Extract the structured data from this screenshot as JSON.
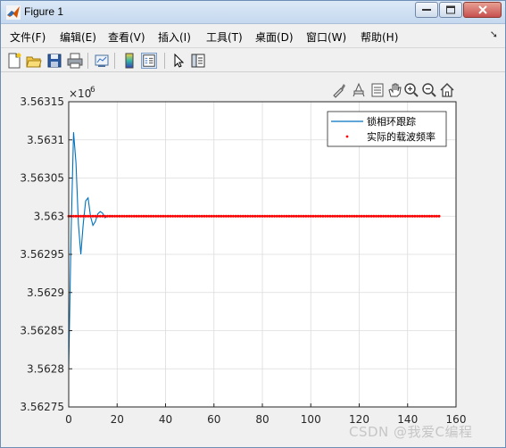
{
  "window": {
    "title": "Figure 1"
  },
  "menu": {
    "items": [
      "文件(F)",
      "编辑(E)",
      "查看(V)",
      "插入(I)",
      "工具(T)",
      "桌面(D)",
      "窗口(W)",
      "帮助(H)"
    ]
  },
  "toolbar": {
    "buttons": [
      "new-figure-icon",
      "open-file-icon",
      "save-icon",
      "print-icon",
      "link-plot-icon",
      "insert-colorbar-icon",
      "insert-legend-icon",
      "pointer-icon",
      "property-editor-icon"
    ]
  },
  "axes_toolbar": {
    "buttons": [
      "brush-icon",
      "data-tips-icon",
      "rotate-icon",
      "pan-icon",
      "zoom-in-icon",
      "zoom-out-icon",
      "home-icon"
    ]
  },
  "colors": {
    "line": "#0072bd",
    "markers": "#ff0000",
    "grid": "#dcdcdc"
  },
  "chart_data": {
    "type": "line",
    "title": "",
    "xlabel": "",
    "ylabel": "",
    "exponent_label": "×10^6",
    "exponent_base": "×10",
    "exponent_power": "6",
    "xlim": [
      0,
      160
    ],
    "ylim": [
      3.56275,
      3.56315
    ],
    "x_ticks": [
      "0",
      "20",
      "40",
      "60",
      "80",
      "100",
      "120",
      "140",
      "160"
    ],
    "y_ticks": [
      "3.56275",
      "3.5628",
      "3.56285",
      "3.5629",
      "3.56295",
      "3.563",
      "3.56305",
      "3.5631",
      "3.56315"
    ],
    "grid": true,
    "legend": {
      "placement": "top-right"
    },
    "series": [
      {
        "name": "锁相环跟踪",
        "style": "line",
        "x": [
          0,
          1,
          2,
          3,
          4,
          5,
          6,
          7,
          8,
          9,
          10,
          11,
          12,
          13,
          14,
          15,
          16,
          17,
          18,
          20,
          30,
          50,
          80,
          120,
          153
        ],
        "y": [
          3.5628,
          3.56298,
          3.56311,
          3.56307,
          3.56299,
          3.56295,
          3.56299,
          3.56302,
          3.563024,
          3.563,
          3.562988,
          3.562993,
          3.563003,
          3.563006,
          3.563004,
          3.562998,
          3.563,
          3.563001,
          3.563,
          3.563,
          3.563,
          3.563,
          3.563,
          3.563,
          3.563
        ]
      },
      {
        "name": "实际的载波频率",
        "style": "markers",
        "x_start": 0,
        "x_end": 153,
        "x_step": 1,
        "y": 3.563
      }
    ]
  },
  "watermark": "CSDN @我爱C编程"
}
